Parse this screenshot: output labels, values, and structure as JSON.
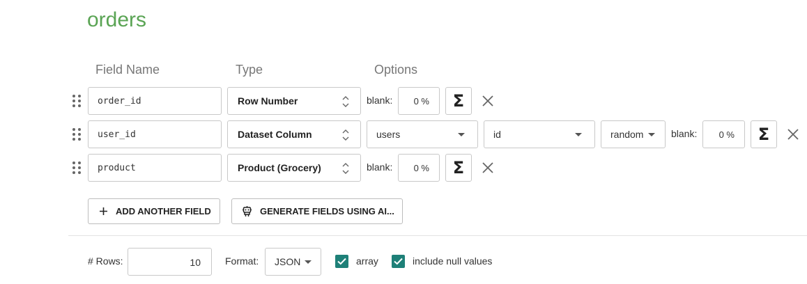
{
  "title": "orders",
  "headers": {
    "field_name": "Field Name",
    "type": "Type",
    "options": "Options"
  },
  "fields": [
    {
      "name": "order_id",
      "type": "Row Number",
      "blank_label": "blank:",
      "blank_pct": "0 %"
    },
    {
      "name": "user_id",
      "type": "Dataset Column",
      "dataset": "users",
      "column": "id",
      "selection": "random",
      "blank_label": "blank:",
      "blank_pct": "0 %"
    },
    {
      "name": "product",
      "type": "Product (Grocery)",
      "blank_label": "blank:",
      "blank_pct": "0 %"
    }
  ],
  "icons": {
    "sigma": "Σ",
    "close": "close-icon",
    "drag": "drag-handle-icon",
    "plus": "plus-icon",
    "robot": "robot-icon"
  },
  "buttons": {
    "add_field": "ADD ANOTHER FIELD",
    "generate_ai": "GENERATE FIELDS USING AI..."
  },
  "footer": {
    "rows_label": "# Rows:",
    "rows_value": "10",
    "format_label": "Format:",
    "format_value": "JSON",
    "array_label": "array",
    "array_checked": true,
    "null_label": "include null values",
    "null_checked": true
  },
  "colors": {
    "title": "#5aa454",
    "checkbox": "#1e8078"
  }
}
